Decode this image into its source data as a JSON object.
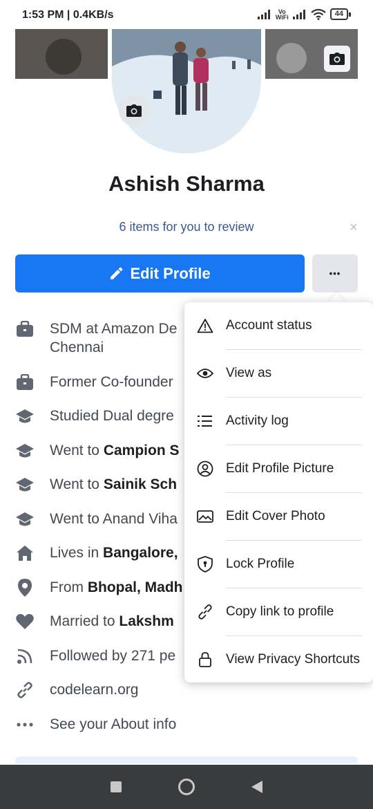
{
  "status_bar": {
    "text": "1:53 PM | 0.4KB/s",
    "volte": "Vo",
    "wifi_label": "WiFi",
    "battery": "44"
  },
  "profile": {
    "name": "Ashish Sharma",
    "review_text": "6 items for you to review",
    "close_glyph": "×",
    "edit_label": "Edit Profile",
    "more_glyph": "•••"
  },
  "info_items": [
    {
      "icon": "briefcase-icon",
      "pre": "SDM at Amazon De",
      "bold": "",
      "line2": "Chennai"
    },
    {
      "icon": "briefcase-icon",
      "pre": "Former Co-founder",
      "bold": "",
      "line2": ""
    },
    {
      "icon": "graduation-cap-icon",
      "pre": "Studied Dual degre",
      "bold": "",
      "line2": ""
    },
    {
      "icon": "graduation-cap-icon",
      "pre": "Went to ",
      "bold": "Campion S",
      "line2": ""
    },
    {
      "icon": "graduation-cap-icon",
      "pre": "Went to ",
      "bold": "Sainik Sch",
      "line2": ""
    },
    {
      "icon": "graduation-cap-icon",
      "pre": "Went to Anand Viha",
      "bold": "",
      "line2": ""
    },
    {
      "icon": "home-icon",
      "pre": "Lives in ",
      "bold": "Bangalore,",
      "line2": ""
    },
    {
      "icon": "location-pin-icon",
      "pre": "From ",
      "bold": "Bhopal, Madh",
      "line2": ""
    },
    {
      "icon": "heart-icon",
      "pre": "Married to ",
      "bold": "Lakshm",
      "line2": ""
    },
    {
      "icon": "rss-icon",
      "pre": "Followed by 271 pe",
      "bold": "",
      "line2": ""
    },
    {
      "icon": "link-icon",
      "pre": "codelearn.org",
      "bold": "",
      "line2": ""
    },
    {
      "icon": "more-dots-icon",
      "pre": "See your About info",
      "bold": "",
      "line2": ""
    }
  ],
  "menu": {
    "items": [
      {
        "icon": "warning-icon",
        "label": "Account status"
      },
      {
        "icon": "eye-icon",
        "label": "View as"
      },
      {
        "icon": "list-icon",
        "label": "Activity log"
      },
      {
        "icon": "user-circle-icon",
        "label": "Edit Profile Picture"
      },
      {
        "icon": "image-icon",
        "label": "Edit Cover Photo"
      },
      {
        "icon": "shield-lock-icon",
        "label": "Lock Profile"
      },
      {
        "icon": "link-icon",
        "label": "Copy link to profile"
      },
      {
        "icon": "lock-icon",
        "label": "View Privacy Shortcuts"
      }
    ]
  },
  "nav": {
    "recents": "recents-square-icon",
    "home": "home-circle-icon",
    "back": "back-triangle-icon"
  },
  "colors": {
    "accent": "#1877f2",
    "link": "#385898",
    "icon_gray": "#606770"
  }
}
